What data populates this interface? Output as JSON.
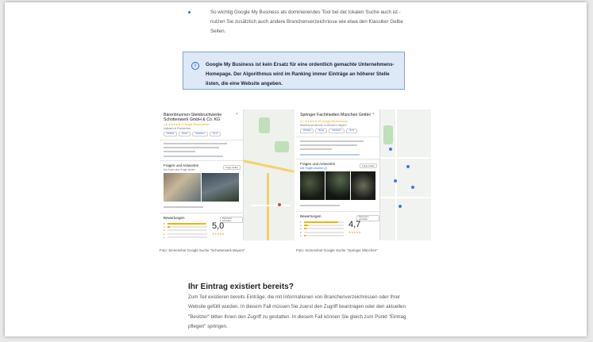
{
  "bullet": {
    "text": "So wichtig Google My Business als dominierendes Tool bei der lokalen Suche auch ist - nutzen Sie zusätzlich auch andere Branchenverzeichnisse wie etwa den Klassiker Gelbe Seiten."
  },
  "infobox": {
    "icon": "i",
    "text": "Google My Business ist kein Ersatz für eine ordentlich gemachte Unternehmens-Homepage. Der Algorithmus wird im Ranking immer Einträge an höherer Stelle listen, die eine Website angeben."
  },
  "screenshots": [
    {
      "title": "Bärenbrunnen-Steinbruchwerke Schottenwerk GmbH & Co. KG",
      "rating_text": "4,8 ★★★★★ 9 Google-Rezensionen",
      "category": "Kalkwerk in Pfarrkirchen",
      "buttons": [
        "Website",
        "Route",
        "Speichern",
        "Anruf"
      ],
      "qa_heading": "Fragen und Antworten",
      "qa_sub": "Als Erster eine Frage stellen",
      "qa_button": "Frage stellen",
      "reviews_heading": "Bewertungen",
      "reviews_button": "Rezension schreiben",
      "score": "5,0",
      "score_stars": "★★★★★",
      "bar_fractions": [
        0.95,
        0.05,
        0.0,
        0.0,
        0.0
      ],
      "caption": "Foto: Screenshot Google Suche \"Schotterwerk Bayern\""
    },
    {
      "title": "Springer Fachmedien München GmbH",
      "rating_text": "4,7 ★★★★★ 15 Google-Rezensionen",
      "category": "Medienunternehmen in München, Bayern",
      "buttons": [
        "Website",
        "Route",
        "Speichern",
        "Anruf"
      ],
      "qa_heading": "Fragen und Antworten",
      "qa_sub": "Alle Fragen ansehen (2)",
      "qa_button": "Frage stellen",
      "reviews_heading": "Bewertungen",
      "reviews_button": "Rezension schreiben",
      "score": "4,7",
      "score_stars": "★★★★★",
      "bar_fractions": [
        0.85,
        0.1,
        0.05,
        0.0,
        0.03
      ],
      "caption": "Foto: Screenshot Google Suche \"Springer München\""
    }
  ],
  "section": {
    "heading": "Ihr Eintrag existiert bereits?",
    "paragraph": "Zum Teil existieren bereits Einträge, die mit Informationen von Branchenverzeichnissen oder Ihrer Website gefüllt wurden. In diesem Fall müssen Sie zuerst den Zugriff beantragen oder den aktuellen \"Besitzer\" bitten Ihnen den Zugriff zu gestatten. In diesem Fall können Sie gleich zum Punkt \"Eintrag pflegen\" springen."
  },
  "colors": {
    "accent": "#2a6bd1",
    "infobox_bg": "#dde9f7",
    "star": "#e5a420"
  }
}
